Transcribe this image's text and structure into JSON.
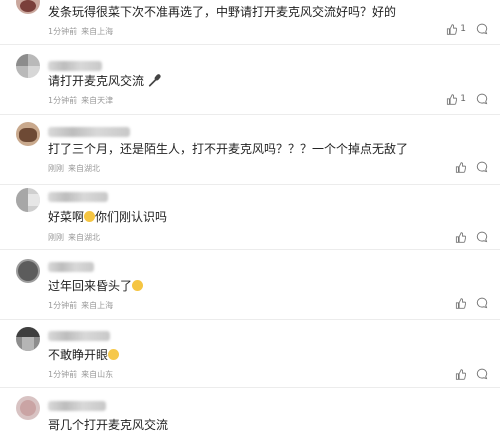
{
  "comments": [
    {
      "text": "发条玩得很菜下次不准再选了，中野请打开麦克风交流好吗？好的",
      "time": "1分钟前",
      "location": "来自上海",
      "likes": "1"
    },
    {
      "text": "请打开麦克风交流",
      "time": "1分钟前",
      "location": "来自天津",
      "likes": "1"
    },
    {
      "text": "打了三个月，还是陌生人，打不开麦克风吗？？？一个个掉点无敌了",
      "time": "刚刚",
      "location": "来自湖北",
      "likes": ""
    },
    {
      "text": "好菜啊",
      "text2": "你们刚认识吗",
      "time": "刚刚",
      "location": "来自湖北",
      "likes": ""
    },
    {
      "text": "过年回来昏头了",
      "time": "1分钟前",
      "location": "来自上海",
      "likes": ""
    },
    {
      "text": "不敢睁开眼",
      "time": "1分钟前",
      "location": "来自山东",
      "likes": ""
    },
    {
      "text": "哥几个打开麦克风交流",
      "time": "",
      "location": "",
      "likes": ""
    }
  ],
  "icons": {
    "like": "thumbs-up-icon",
    "reply": "comment-icon",
    "mic": "microphone-icon",
    "emoji": "smiley-emoji"
  },
  "colors": {
    "meta_text": "#9a9a9a",
    "divider": "#ececec",
    "emoji": "#f5c542"
  }
}
